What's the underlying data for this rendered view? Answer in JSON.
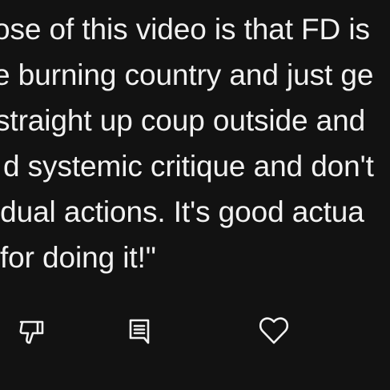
{
  "comment": {
    "lines": [
      "ose of this video is that FD is",
      "e burning country and just ge",
      "straight up coup outside and",
      "d systemic critique and don't",
      "idual actions. It's good actua",
      " for doing it!\""
    ]
  },
  "actions": {
    "dislike_icon": "thumbs-down-outline",
    "reply_icon": "comment-outline",
    "like_icon": "heart-outline"
  },
  "colors": {
    "background": "#121212",
    "text": "#f1f1f1",
    "icon": "#f1f1f1"
  }
}
